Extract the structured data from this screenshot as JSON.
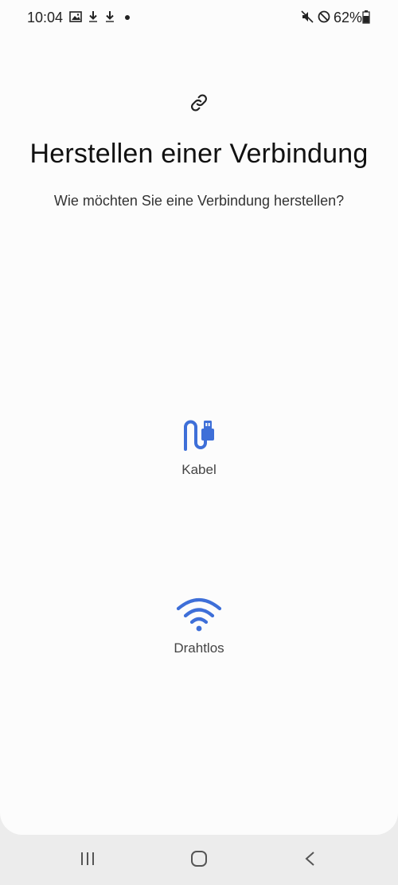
{
  "status_bar": {
    "time": "10:04",
    "battery_percent": "62%",
    "left_icons": [
      "image-icon",
      "download-icon",
      "download-icon",
      "dot-icon"
    ],
    "right_icons": [
      "mute-icon",
      "do-not-disturb-icon",
      "battery-icon"
    ]
  },
  "header": {
    "icon": "link-icon",
    "title": "Herstellen einer Verbindung",
    "subtitle": "Wie möchten Sie eine Verbindung herstellen?"
  },
  "options": [
    {
      "icon": "usb-cable-icon",
      "label": "Kabel"
    },
    {
      "icon": "wifi-icon",
      "label": "Drahtlos"
    }
  ],
  "nav_bar": {
    "buttons": [
      "recent-apps-icon",
      "home-icon",
      "back-icon"
    ]
  },
  "colors": {
    "accent": "#3e6fd8",
    "background": "#fcfcfc",
    "nav_background": "#ececec"
  }
}
